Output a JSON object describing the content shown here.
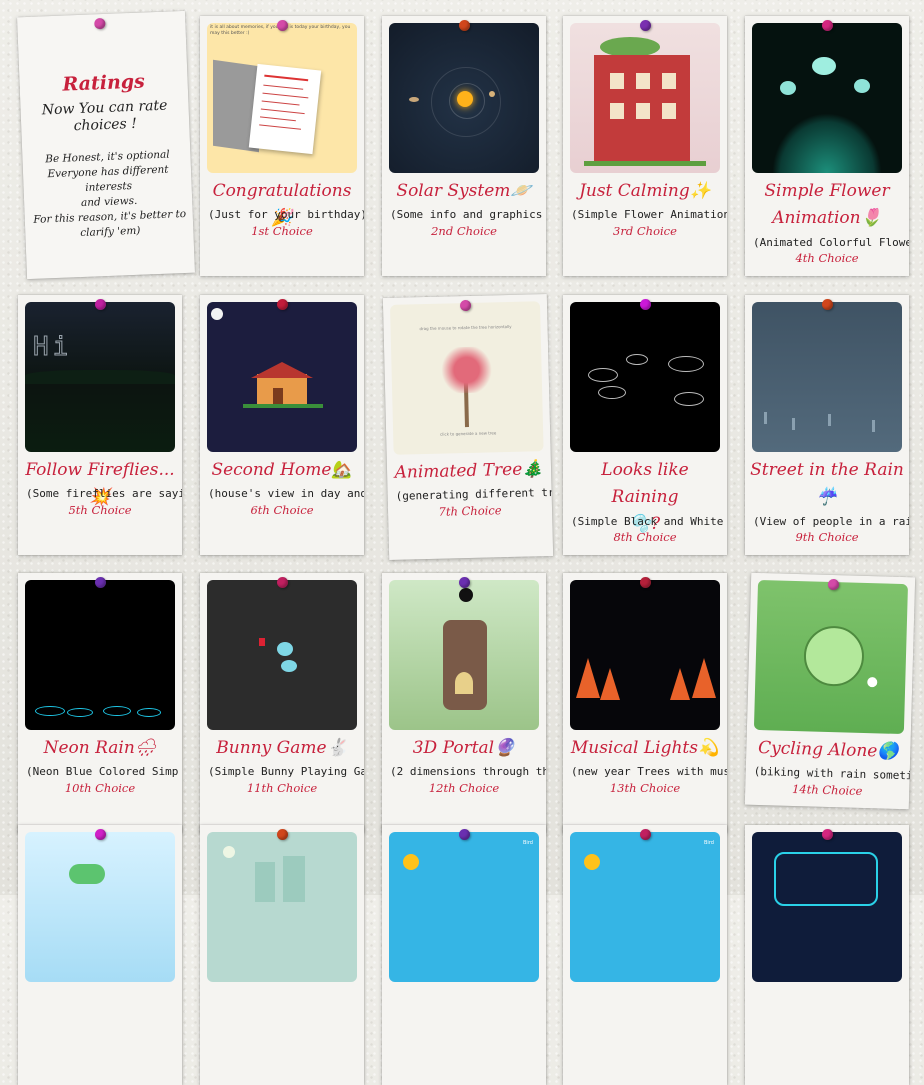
{
  "intro": {
    "title": "Ratings",
    "subtitle_line1": "Now You can rate",
    "subtitle_line2": "choices !",
    "body_line1": "Be Honest, it's optional",
    "body_line2": "Everyone has different interests",
    "body_line3": "and views.",
    "body_line4": "For this reason, it's better to",
    "body_line5": "clarify 'em)"
  },
  "cards": [
    {
      "title": "Congratulations🎉",
      "desc": "(Just for your birthday)",
      "rank": "1st Choice",
      "pin": "#d44aa8",
      "inner_text": "it is all about memories, if you this is today your birthday, you may this better :)"
    },
    {
      "title": "Solar System🪐",
      "desc": "(Some info and graphics",
      "rank": "2nd Choice",
      "pin": "#d0461c"
    },
    {
      "title": "Just Calming✨",
      "desc": "(Simple Flower Animation",
      "rank": "3rd Choice",
      "pin": "#7a2fb0"
    },
    {
      "title_line1": "Simple Flower",
      "title_line2": "Animation🌷",
      "desc": "(Animated Colorful Flowe",
      "rank": "4th Choice",
      "pin": "#d4267f"
    },
    {
      "title": "Follow Fireflies...💥",
      "desc": "(Some fireflies are sayi",
      "rank": "5th Choice",
      "pin": "#c020a0",
      "inner_text": "Hi"
    },
    {
      "title": "Second Home🏡",
      "desc": "(house's view in day and",
      "rank": "6th Choice",
      "pin": "#c11c3a"
    },
    {
      "title": "Animated Tree🎄",
      "desc": "(generating different tr",
      "rank": "7th Choice",
      "pin": "#d44aa8",
      "inner_text_top": "drag the mouse to rotate the tree horizontally",
      "inner_text_bottom": "click to generate a new tree"
    },
    {
      "title_line1": "Looks like Raining",
      "title_line2": "🫧?",
      "desc": "(Simple Black and White",
      "rank": "8th Choice",
      "pin": "#cc18d8"
    },
    {
      "title_line1": "Street in the Rain",
      "title_line2": "☔",
      "desc": "(View of people in a rai",
      "rank": "9th Choice",
      "pin": "#d0461c"
    },
    {
      "title": "Neon Rain🌧",
      "desc": "(Neon  Blue Colored Simp",
      "rank": "10th Choice",
      "pin": "#6a2fb0"
    },
    {
      "title": "Bunny Game🐇",
      "desc": "(Simple Bunny Playing Ga",
      "rank": "11th Choice",
      "pin": "#c12060"
    },
    {
      "title": "3D Portal🔮",
      "desc": "(2 dimensions through the",
      "rank": "12th Choice",
      "pin": "#6a2fb0"
    },
    {
      "title": "Musical Lights💫",
      "desc": "(new year Trees with mus",
      "rank": "13th Choice",
      "pin": "#b4203a"
    },
    {
      "title": "Cycling Alone🌎",
      "desc": "(biking with rain someti",
      "rank": "14th Choice",
      "pin": "#d44aa8"
    },
    {
      "pin": "#d020c8"
    },
    {
      "pin": "#d0461c"
    },
    {
      "pin": "#6a2fb0",
      "inner_text": "Bird"
    },
    {
      "pin": "#c12060",
      "inner_text": "Bird"
    },
    {
      "pin": "#d4267f"
    }
  ],
  "colors": {
    "accent": "#c7213c",
    "text": "#222222",
    "paper": "#f5f4f1"
  }
}
